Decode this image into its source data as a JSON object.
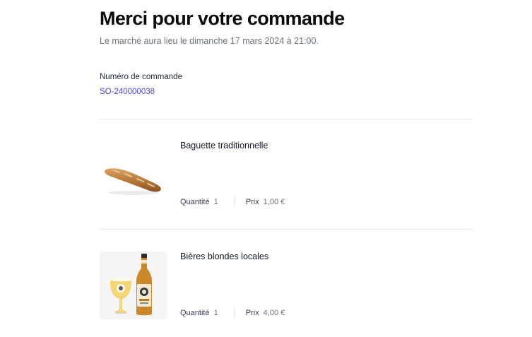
{
  "header": {
    "title": "Merci pour votre commande",
    "subtitle": "Le marché aura lieu le dimanche 17 mars 2024 à 21:00."
  },
  "order": {
    "label": "Numéro de commande",
    "number": "SO-240000038"
  },
  "items": [
    {
      "name": "Baguette traditionnelle",
      "quantity_label": "Quantité",
      "quantity": "1",
      "price_label": "Prix",
      "price": "1,00 €",
      "image": "baguette-image"
    },
    {
      "name": "Bières blondes locales",
      "quantity_label": "Quantité",
      "quantity": "1",
      "price_label": "Prix",
      "price": "4,00 €",
      "image": "beer-image"
    }
  ],
  "colors": {
    "accent": "#4f46e5",
    "divider": "#e5e7eb"
  }
}
